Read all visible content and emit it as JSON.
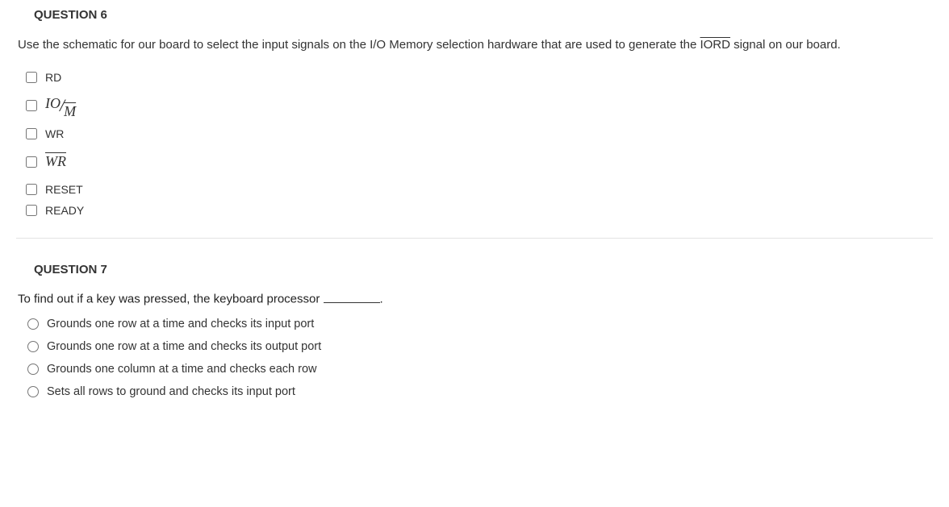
{
  "q6": {
    "header": "QUESTION 6",
    "prompt_a": "Use the schematic for our board to select the input signals on the I/O Memory selection hardware that are used to generate the ",
    "prompt_signal": "IORD",
    "prompt_b": " signal on our board.",
    "options": {
      "rd": "RD",
      "io_num": "IO",
      "io_den": "M",
      "wr": "WR",
      "wr_bar": "WR",
      "reset": "RESET",
      "ready": "READY"
    }
  },
  "q7": {
    "header": "QUESTION 7",
    "prompt": "To find out if a key was pressed, the keyboard processor ",
    "prompt_suffix": ".",
    "options": {
      "a": "Grounds one row at a time and checks its input port",
      "b": "Grounds one row at a time and checks its output port",
      "c": "Grounds one column at a time and checks each row",
      "d": "Sets all rows to ground and checks its input port"
    }
  }
}
